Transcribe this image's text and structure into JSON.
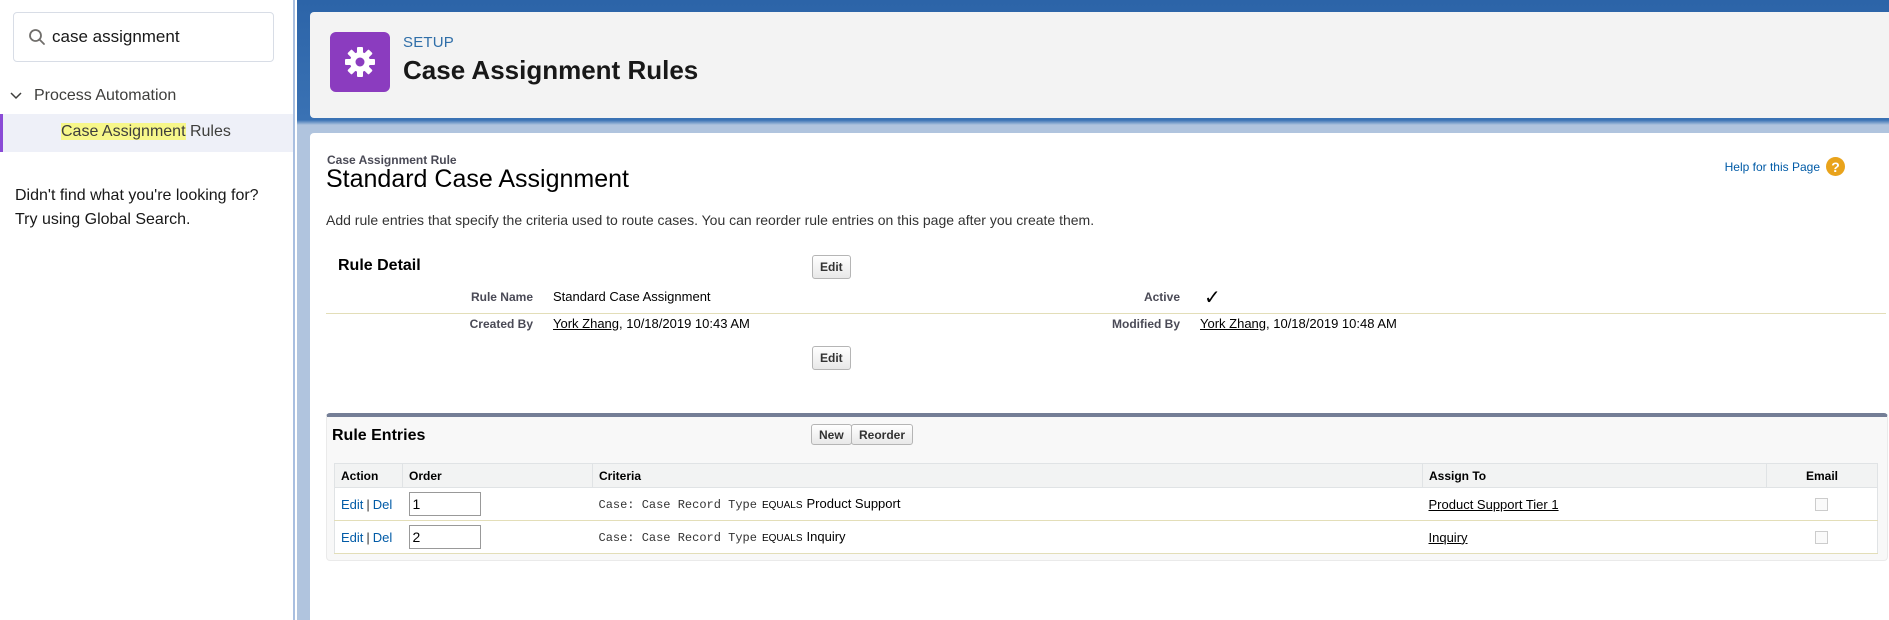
{
  "sidebar": {
    "search_value": "case assignment",
    "tree_parent": "Process Automation",
    "tree_child_highlight": "Case Assignment",
    "tree_child_rest": " Rules",
    "not_found_line1": "Didn't find what you're looking for?",
    "not_found_line2": "Try using Global Search."
  },
  "header": {
    "setup_label": "SETUP",
    "title": "Case Assignment Rules"
  },
  "content": {
    "breadcrumb": "Case Assignment Rule",
    "rule_title": "Standard Case Assignment",
    "help_link": "Help for this Page",
    "description": "Add rule entries that specify the criteria used to route cases. You can reorder rule entries on this page after you create them."
  },
  "rule_detail": {
    "section_title": "Rule Detail",
    "edit_label": "Edit",
    "rule_name_label": "Rule Name",
    "rule_name_value": "Standard Case Assignment",
    "active_label": "Active",
    "active_check": "✓",
    "created_by_label": "Created By",
    "created_by_user": "York Zhang",
    "created_by_date": ", 10/18/2019 10:43 AM",
    "modified_by_label": "Modified By",
    "modified_by_user": "York Zhang",
    "modified_by_date": ", 10/18/2019 10:48 AM"
  },
  "rule_entries": {
    "section_title": "Rule Entries",
    "new_label": "New",
    "reorder_label": "Reorder",
    "columns": [
      "Action",
      "Order",
      "Criteria",
      "Assign To",
      "Email"
    ],
    "rows": [
      {
        "edit": "Edit",
        "sep": "|",
        "del": "Del",
        "order": "1",
        "criteria_field": "Case: Case Record Type",
        "criteria_op": "EQUALS",
        "criteria_value": "Product Support",
        "assign_to": "Product Support Tier 1"
      },
      {
        "edit": "Edit",
        "sep": "|",
        "del": "Del",
        "order": "2",
        "criteria_field": "Case: Case Record Type",
        "criteria_op": "EQUALS",
        "criteria_value": "Inquiry",
        "assign_to": "Inquiry"
      }
    ]
  },
  "colors": {
    "setup_icon_bg": "#8b3cbf",
    "link_blue": "#015ba7",
    "help_icon": "#e9a31b"
  }
}
